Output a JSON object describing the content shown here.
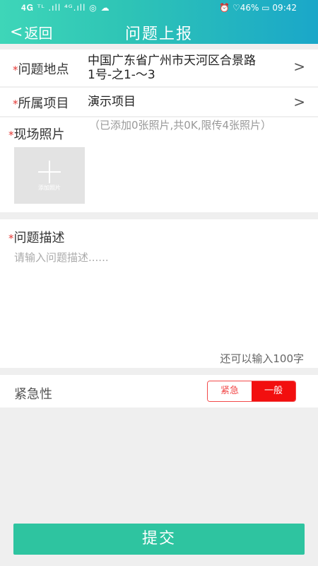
{
  "status_bar": {
    "left": "𝟒𝐆 ᵀᴸ .ıll ⁴ᴳ.ıll ◎ ☁",
    "right": "⏰ ♡46% ▭ 09:42"
  },
  "header": {
    "back_label": "返回",
    "title": "问题上报"
  },
  "location": {
    "required": "*",
    "label": "问题地点",
    "value_line1": "中国广东省广州市天河区合景路",
    "value_line2": "1号-之1-～3"
  },
  "project": {
    "required": "*",
    "label": "所属项目",
    "value": "演示项目"
  },
  "photos": {
    "required": "*",
    "label": "现场照片",
    "hint": "（已添加0张照片,共0K,限传4张照片）",
    "add_label": "添加照片"
  },
  "description": {
    "required": "*",
    "label": "问题描述",
    "placeholder": "请输入问题描述......",
    "counter": "还可以输入100字"
  },
  "urgency": {
    "label": "紧急性",
    "options": [
      "紧急",
      "一般"
    ],
    "selected": "一般"
  },
  "submit_label": "提交",
  "colors": {
    "accent": "#2ec4a0",
    "required": "#e53935",
    "urgent_red": "#f20f0f"
  }
}
